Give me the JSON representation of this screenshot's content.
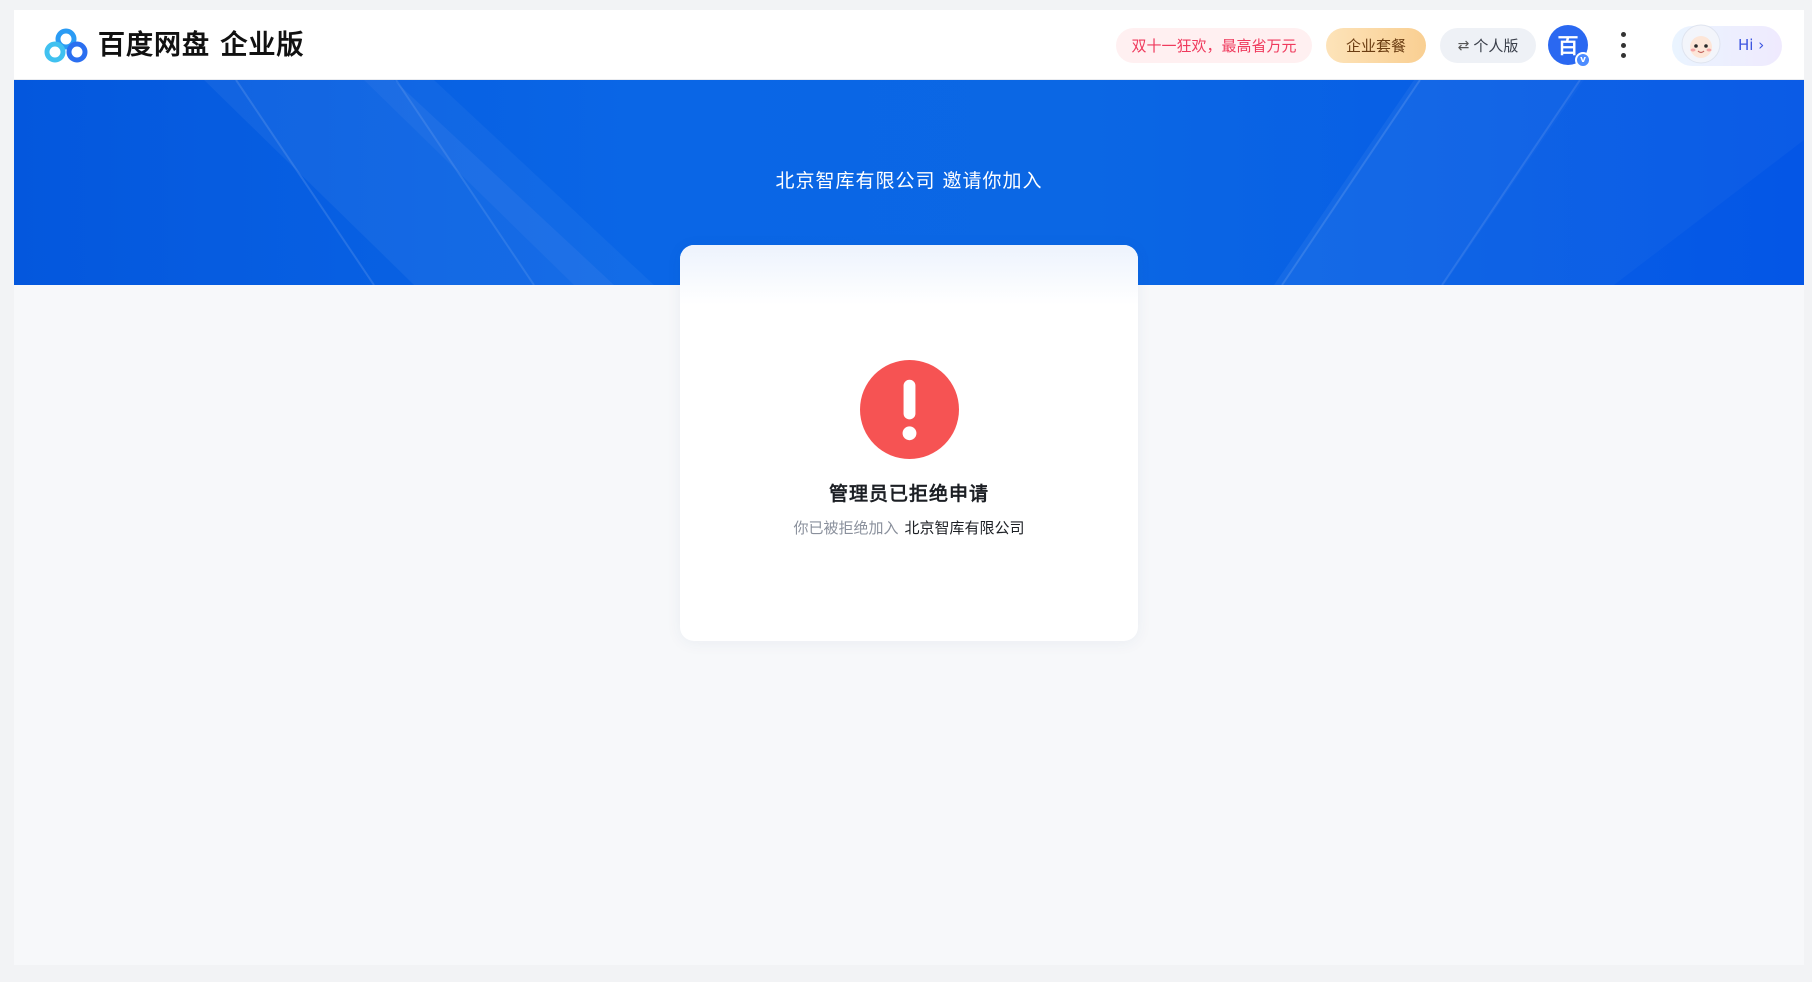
{
  "header": {
    "logo_text": "百度网盘 企业版",
    "promo_label": "双十一狂欢，最高省万元",
    "suite_label": "企业套餐",
    "personal_label": "个人版",
    "avatar_char": "百",
    "avatar_badge": "v",
    "assistant_label": "Hi ›"
  },
  "banner": {
    "title": "北京智库有限公司 邀请你加入"
  },
  "result": {
    "title": "管理员已拒绝申请",
    "subtitle_prefix": "你已被拒绝加入",
    "company": "北京智库有限公司"
  },
  "colors": {
    "primary": "#0a66e6",
    "error": "#f65353",
    "promo_text": "#ef3a5d"
  }
}
